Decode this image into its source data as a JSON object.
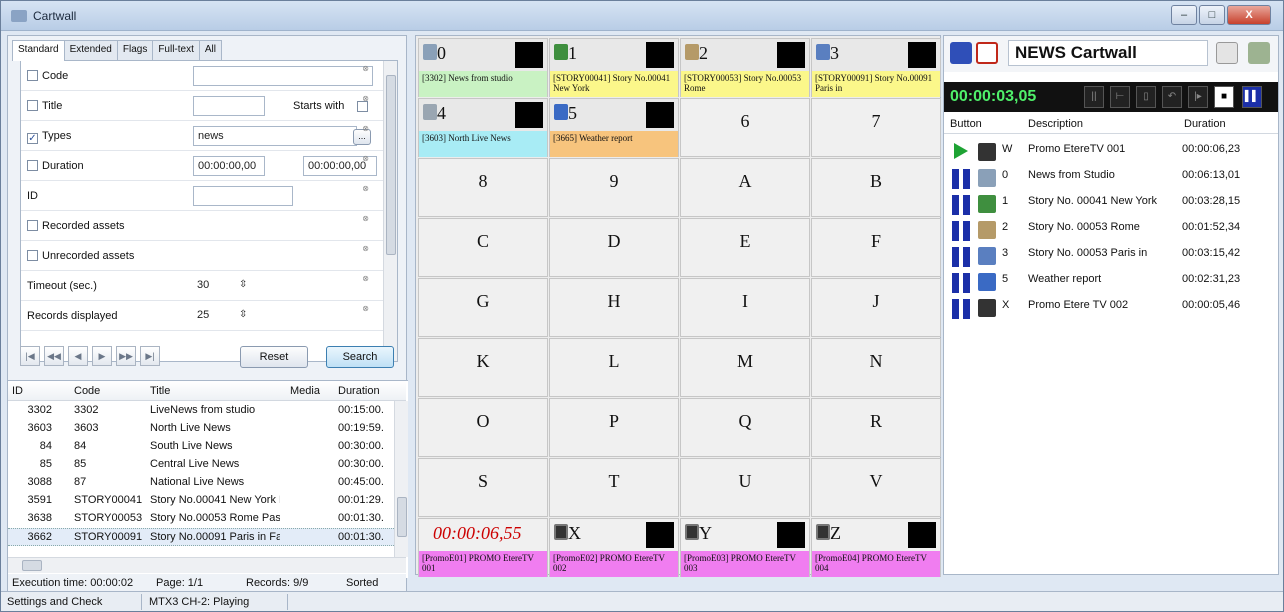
{
  "window": {
    "title": "Cartwall",
    "min_label": "–",
    "max_label": "□",
    "close_label": "X"
  },
  "tabs": [
    "Standard",
    "Extended",
    "Flags",
    "Full-text",
    "All"
  ],
  "filters": {
    "code": {
      "label": "Code",
      "checked": false,
      "value": ""
    },
    "title": {
      "label": "Title",
      "checked": false,
      "value": "",
      "starts_with_label": "Starts with"
    },
    "types": {
      "label": "Types",
      "checked": true,
      "value": "news",
      "browse_label": "..."
    },
    "duration": {
      "label": "Duration",
      "checked": false,
      "from": "00:00:00,00",
      "to": "00:00:00,00"
    },
    "id": {
      "label": "ID",
      "value": ""
    },
    "recorded": {
      "label": "Recorded assets",
      "checked": false
    },
    "unrecorded": {
      "label": "Unrecorded assets",
      "checked": false
    },
    "timeout": {
      "label": "Timeout (sec.)",
      "value": "30"
    },
    "records": {
      "label": "Records displayed",
      "value": "25"
    }
  },
  "actions": {
    "reset": "Reset",
    "search": "Search"
  },
  "results": {
    "columns": [
      "ID",
      "Code",
      "Title",
      "Media",
      "Duration"
    ],
    "rows": [
      {
        "id": "3302",
        "code": "3302",
        "title": "LiveNews from studio",
        "media": "",
        "duration": "00:15:00."
      },
      {
        "id": "3603",
        "code": "3603",
        "title": "North Live News",
        "media": "",
        "duration": "00:19:59."
      },
      {
        "id": "84",
        "code": "84",
        "title": "South Live News",
        "media": "",
        "duration": "00:30:00."
      },
      {
        "id": "85",
        "code": "85",
        "title": "Central Live News",
        "media": "",
        "duration": "00:30:00."
      },
      {
        "id": "3088",
        "code": "87",
        "title": "National Live News",
        "media": "",
        "duration": "00:45:00."
      },
      {
        "id": "3591",
        "code": "STORY00041",
        "title": "Story No.00041 New York F",
        "media": "",
        "duration": "00:01:29."
      },
      {
        "id": "3638",
        "code": "STORY00053",
        "title": "Story No.00053 Rome Pass",
        "media": "",
        "duration": "00:01:30."
      },
      {
        "id": "3662",
        "code": "STORY00091",
        "title": "Story No.00091 Paris in Fas",
        "media": "",
        "duration": "00:01:30."
      }
    ]
  },
  "exec_status": {
    "execution": "Execution time: 00:00:02",
    "page": "Page: 1/1",
    "records": "Records: 9/9",
    "sorted": "Sorted"
  },
  "cartwall": {
    "assigned": [
      {
        "key": "0",
        "label": "[3302] News from studio",
        "color": "#c9f2c3"
      },
      {
        "key": "1",
        "label": "[STORY00041] Story No.00041 New York",
        "color": "#fbf78a"
      },
      {
        "key": "2",
        "label": "[STORY00053] Story No.00053 Rome",
        "color": "#fbf78a"
      },
      {
        "key": "3",
        "label": "[STORY00091] Story No.00091 Paris in",
        "color": "#fbf78a"
      },
      {
        "key": "4",
        "label": "[3603] North Live News",
        "color": "#a8ecf5"
      },
      {
        "key": "5",
        "label": "[3665] Weather report",
        "color": "#f7c47d"
      }
    ],
    "empty_keys": [
      "6",
      "7",
      "8",
      "9",
      "A",
      "B",
      "C",
      "D",
      "E",
      "F",
      "G",
      "H",
      "I",
      "J",
      "K",
      "L",
      "M",
      "N",
      "O",
      "P",
      "Q",
      "R",
      "S",
      "T",
      "U",
      "V"
    ],
    "timer": "00:00:06,55",
    "promos": [
      {
        "key": "X",
        "label": "[PromoE02] PROMO EtereTV 002"
      },
      {
        "key": "Y",
        "label": "[PromoE03] PROMO EtereTV 003"
      },
      {
        "key": "Z",
        "label": "[PromoE04] PROMO EtereTV 004"
      }
    ],
    "timer_label": "[PromoE01] PROMO EtereTV 001"
  },
  "playlist": {
    "title": "NEWS Cartwall",
    "time": "00:00:03,05",
    "columns": [
      "Button",
      "Description",
      "Duration"
    ],
    "rows": [
      {
        "button": "W",
        "description": "Promo EtereTV 001",
        "duration": "00:00:06,23",
        "state": "playing"
      },
      {
        "button": "0",
        "description": "News from Studio",
        "duration": "00:06:13,01",
        "state": "paused"
      },
      {
        "button": "1",
        "description": "Story No. 00041 New York",
        "duration": "00:03:28,15",
        "state": "paused"
      },
      {
        "button": "2",
        "description": "Story No. 00053 Rome",
        "duration": "00:01:52,34",
        "state": "paused"
      },
      {
        "button": "3",
        "description": "Story No. 00053 Paris in",
        "duration": "00:03:15,42",
        "state": "paused"
      },
      {
        "button": "5",
        "description": "Weather report",
        "duration": "00:02:31,23",
        "state": "paused"
      },
      {
        "button": "X",
        "description": "Promo Etere TV 002",
        "duration": "00:00:05,46",
        "state": "paused"
      }
    ]
  },
  "statusbar": {
    "left": "Settings and Check",
    "right": "MTX3 CH-2: Playing"
  }
}
